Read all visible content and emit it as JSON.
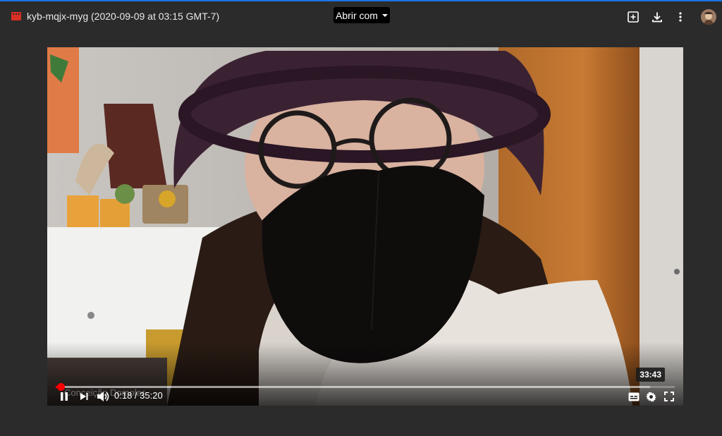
{
  "header": {
    "file_title": "kyb-mqjx-myg (2020-09-09 at 03:15 GMT-7)",
    "open_with_label": "Abrir com",
    "icons": [
      "video-file-icon",
      "add-to-drive-icon",
      "download-icon",
      "more-vert-icon"
    ]
  },
  "player": {
    "hover_time": "33:43",
    "current_time": "0:18",
    "separator": " / ",
    "duration": "35:20",
    "caption_name": "Conceição Domolar",
    "progress_played_fraction": 0.0085,
    "progress_buffer_fraction": 0.96,
    "controls": [
      "play-pause-button",
      "next-button",
      "volume-button",
      "captions-button",
      "settings-button",
      "fullscreen-button"
    ]
  },
  "colors": {
    "background": "#2b2b2b",
    "accent": "#ff0000",
    "file_icon": "#d93025"
  }
}
